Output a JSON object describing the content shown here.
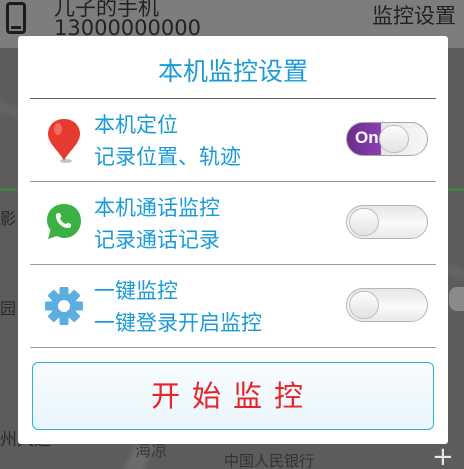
{
  "background": {
    "device_name": "儿子的手机",
    "device_phone": "13000000000",
    "header_title": "监控设置",
    "map_labels": {
      "left_1": "影",
      "left_2": "园",
      "bottom_left": "州大道",
      "bottom_mid": "海凉",
      "bottom": "中国人民银行"
    },
    "zoom_in": "+"
  },
  "dialog": {
    "title": "本机监控设置",
    "rows": [
      {
        "title": "本机定位",
        "description": "记录位置、轨迹",
        "toggle_on": true,
        "toggle_label": "On",
        "icon": "location-pin-icon"
      },
      {
        "title": "本机通话监控",
        "description": "记录通话记录",
        "toggle_on": false,
        "icon": "phone-chat-icon"
      },
      {
        "title": "一键监控",
        "description": "一键登录开启监控",
        "toggle_on": false,
        "icon": "gear-icon"
      }
    ],
    "start_button": "开始监控"
  },
  "colors": {
    "accent": "#1a9bd6",
    "start_text": "#e8232b",
    "toggle_on": "#7a35a0",
    "pin": "#e53a2e",
    "chat": "#3cb043",
    "gear": "#5aaee0"
  }
}
